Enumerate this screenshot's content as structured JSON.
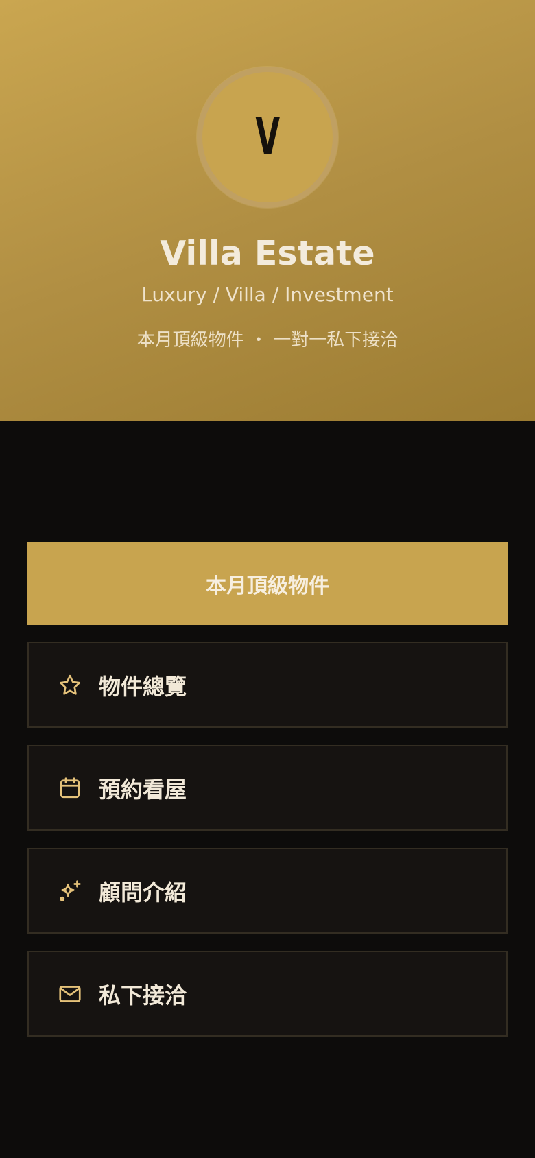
{
  "profile": {
    "avatar_letter": "V",
    "title": "Villa Estate",
    "subtitle": "Luxury / Villa / Investment",
    "tagline": "本月頂級物件 ・ 一對一私下接洽"
  },
  "featured": {
    "label": "本月頂級物件"
  },
  "menu": {
    "items": [
      {
        "label": "物件總覽",
        "icon": "star-icon"
      },
      {
        "label": "預約看屋",
        "icon": "calendar-icon"
      },
      {
        "label": "顧問介紹",
        "icon": "sparkles-icon"
      },
      {
        "label": "私下接洽",
        "icon": "mail-icon"
      }
    ]
  },
  "colors": {
    "gold": "#c8a44f",
    "background": "#0d0c0b",
    "card": "#161311",
    "icon": "#e5c27a"
  }
}
